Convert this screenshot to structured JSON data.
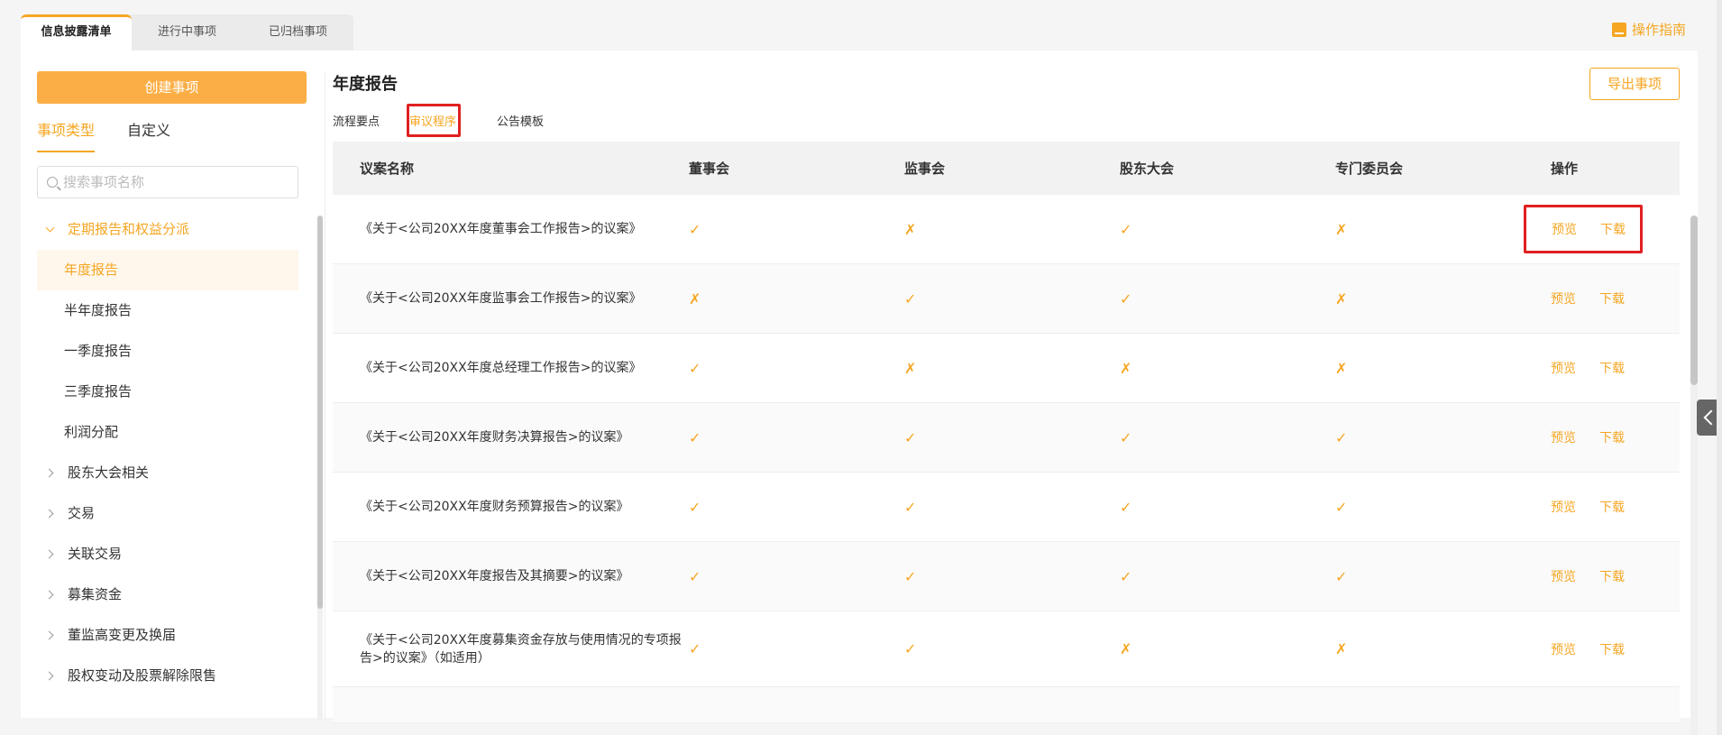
{
  "top_tabs": [
    {
      "label": "信息披露清单"
    },
    {
      "label": "进行中事项"
    },
    {
      "label": "已归档事项"
    }
  ],
  "guide_label": "操作指南",
  "sidebar": {
    "create_label": "创建事项",
    "tabs": [
      {
        "label": "事项类型"
      },
      {
        "label": "自定义"
      }
    ],
    "search_placeholder": "搜索事项名称",
    "groups": [
      {
        "label": "定期报告和权益分派"
      },
      {
        "label": "股东大会相关"
      },
      {
        "label": "交易"
      },
      {
        "label": "关联交易"
      },
      {
        "label": "募集资金"
      },
      {
        "label": "董监高变更及换届"
      },
      {
        "label": "股权变动及股票解除限售"
      }
    ],
    "children": [
      {
        "label": "年度报告"
      },
      {
        "label": "半年度报告"
      },
      {
        "label": "一季度报告"
      },
      {
        "label": "三季度报告"
      },
      {
        "label": "利润分配"
      }
    ]
  },
  "content": {
    "title": "年度报告",
    "export_label": "导出事项",
    "sub_tabs": [
      {
        "label": "流程要点"
      },
      {
        "label": "审议程序"
      },
      {
        "label": "公告模板"
      }
    ],
    "headers": [
      "议案名称",
      "董事会",
      "监事会",
      "股东大会",
      "专门委员会",
      "操作"
    ],
    "preview_label": "预览",
    "download_label": "下载",
    "rows": [
      {
        "name": "《关于<公司20XX年度董事会工作报告>的议案》",
        "marks": [
          "✓",
          "✗",
          "✓",
          "✗"
        ]
      },
      {
        "name": "《关于<公司20XX年度监事会工作报告>的议案》",
        "marks": [
          "✗",
          "✓",
          "✓",
          "✗"
        ]
      },
      {
        "name": "《关于<公司20XX年度总经理工作报告>的议案》",
        "marks": [
          "✓",
          "✗",
          "✗",
          "✗"
        ]
      },
      {
        "name": "《关于<公司20XX年度财务决算报告>的议案》",
        "marks": [
          "✓",
          "✓",
          "✓",
          "✓"
        ]
      },
      {
        "name": "《关于<公司20XX年度财务预算报告>的议案》",
        "marks": [
          "✓",
          "✓",
          "✓",
          "✓"
        ]
      },
      {
        "name": "《关于<公司20XX年度报告及其摘要>的议案》",
        "marks": [
          "✓",
          "✓",
          "✓",
          "✓"
        ]
      },
      {
        "name": "《关于<公司20XX年度募集资金存放与使用情况的专项报告>的议案》（如适用）",
        "marks": [
          "✓",
          "✓",
          "✗",
          "✗"
        ]
      }
    ]
  },
  "colors": {
    "accent": "#f5a623",
    "highlight": "#e02020"
  }
}
